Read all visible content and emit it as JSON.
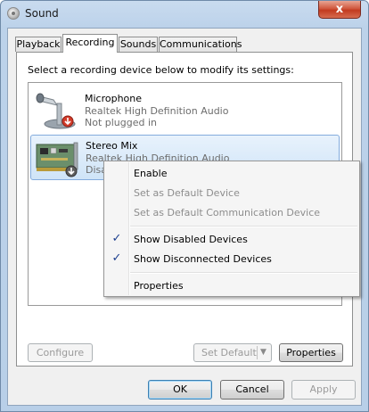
{
  "window": {
    "title": "Sound",
    "close_glyph": "x"
  },
  "tabs": [
    "Playback",
    "Recording",
    "Sounds",
    "Communications"
  ],
  "instructions": "Select a recording device below to modify its settings:",
  "devices": [
    {
      "name": "Microphone",
      "driver": "Realtek High Definition Audio",
      "status": "Not plugged in",
      "icon": "microphone-icon",
      "badge": "red-down-arrow"
    },
    {
      "name": "Stereo Mix",
      "driver": "Realtek High Definition Audio",
      "status": "Disa",
      "icon": "sound-card-icon",
      "badge": "gray-down-arrow"
    }
  ],
  "context_menu": {
    "items": [
      {
        "label": "Enable",
        "enabled": true,
        "checked": false
      },
      {
        "label": "Set as Default Device",
        "enabled": false,
        "checked": false
      },
      {
        "label": "Set as Default Communication Device",
        "enabled": false,
        "checked": false
      },
      {
        "label": "Show Disabled Devices",
        "enabled": true,
        "checked": true
      },
      {
        "label": "Show Disconnected Devices",
        "enabled": true,
        "checked": true
      },
      {
        "label": "Properties",
        "enabled": true,
        "checked": false
      }
    ],
    "check_glyph": "✓"
  },
  "panel_buttons": {
    "configure": "Configure",
    "set_default": "Set Default",
    "properties": "Properties"
  },
  "dialog_buttons": {
    "ok": "OK",
    "cancel": "Cancel",
    "apply": "Apply"
  },
  "colors": {
    "selection_border": "#84acdd",
    "check": "#1c3f8f",
    "close_button": "#c23a1f"
  }
}
